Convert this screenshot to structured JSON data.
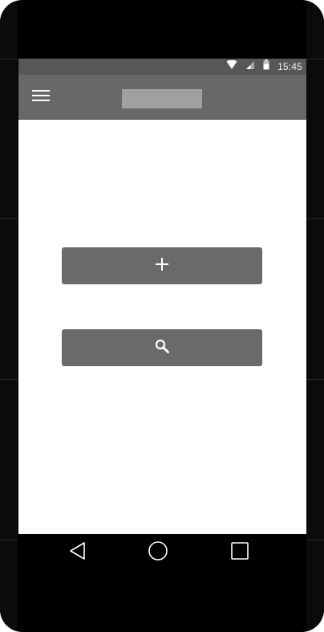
{
  "status_bar": {
    "time": "15:45",
    "icons": [
      "wifi-icon",
      "signal-icon",
      "battery-icon"
    ]
  },
  "app_bar": {
    "menu_icon": "hamburger-menu-icon",
    "title": ""
  },
  "main": {
    "buttons": [
      {
        "name": "add-button",
        "icon": "plus-icon"
      },
      {
        "name": "search-button",
        "icon": "search-icon"
      }
    ]
  },
  "nav_bar": {
    "buttons": [
      "back-icon",
      "home-icon",
      "recents-icon"
    ]
  },
  "colors": {
    "device": "#000000",
    "status_bar": "#575757",
    "app_bar": "#686868",
    "button": "#6a6a6a",
    "title_placeholder": "#a0a0a0"
  }
}
